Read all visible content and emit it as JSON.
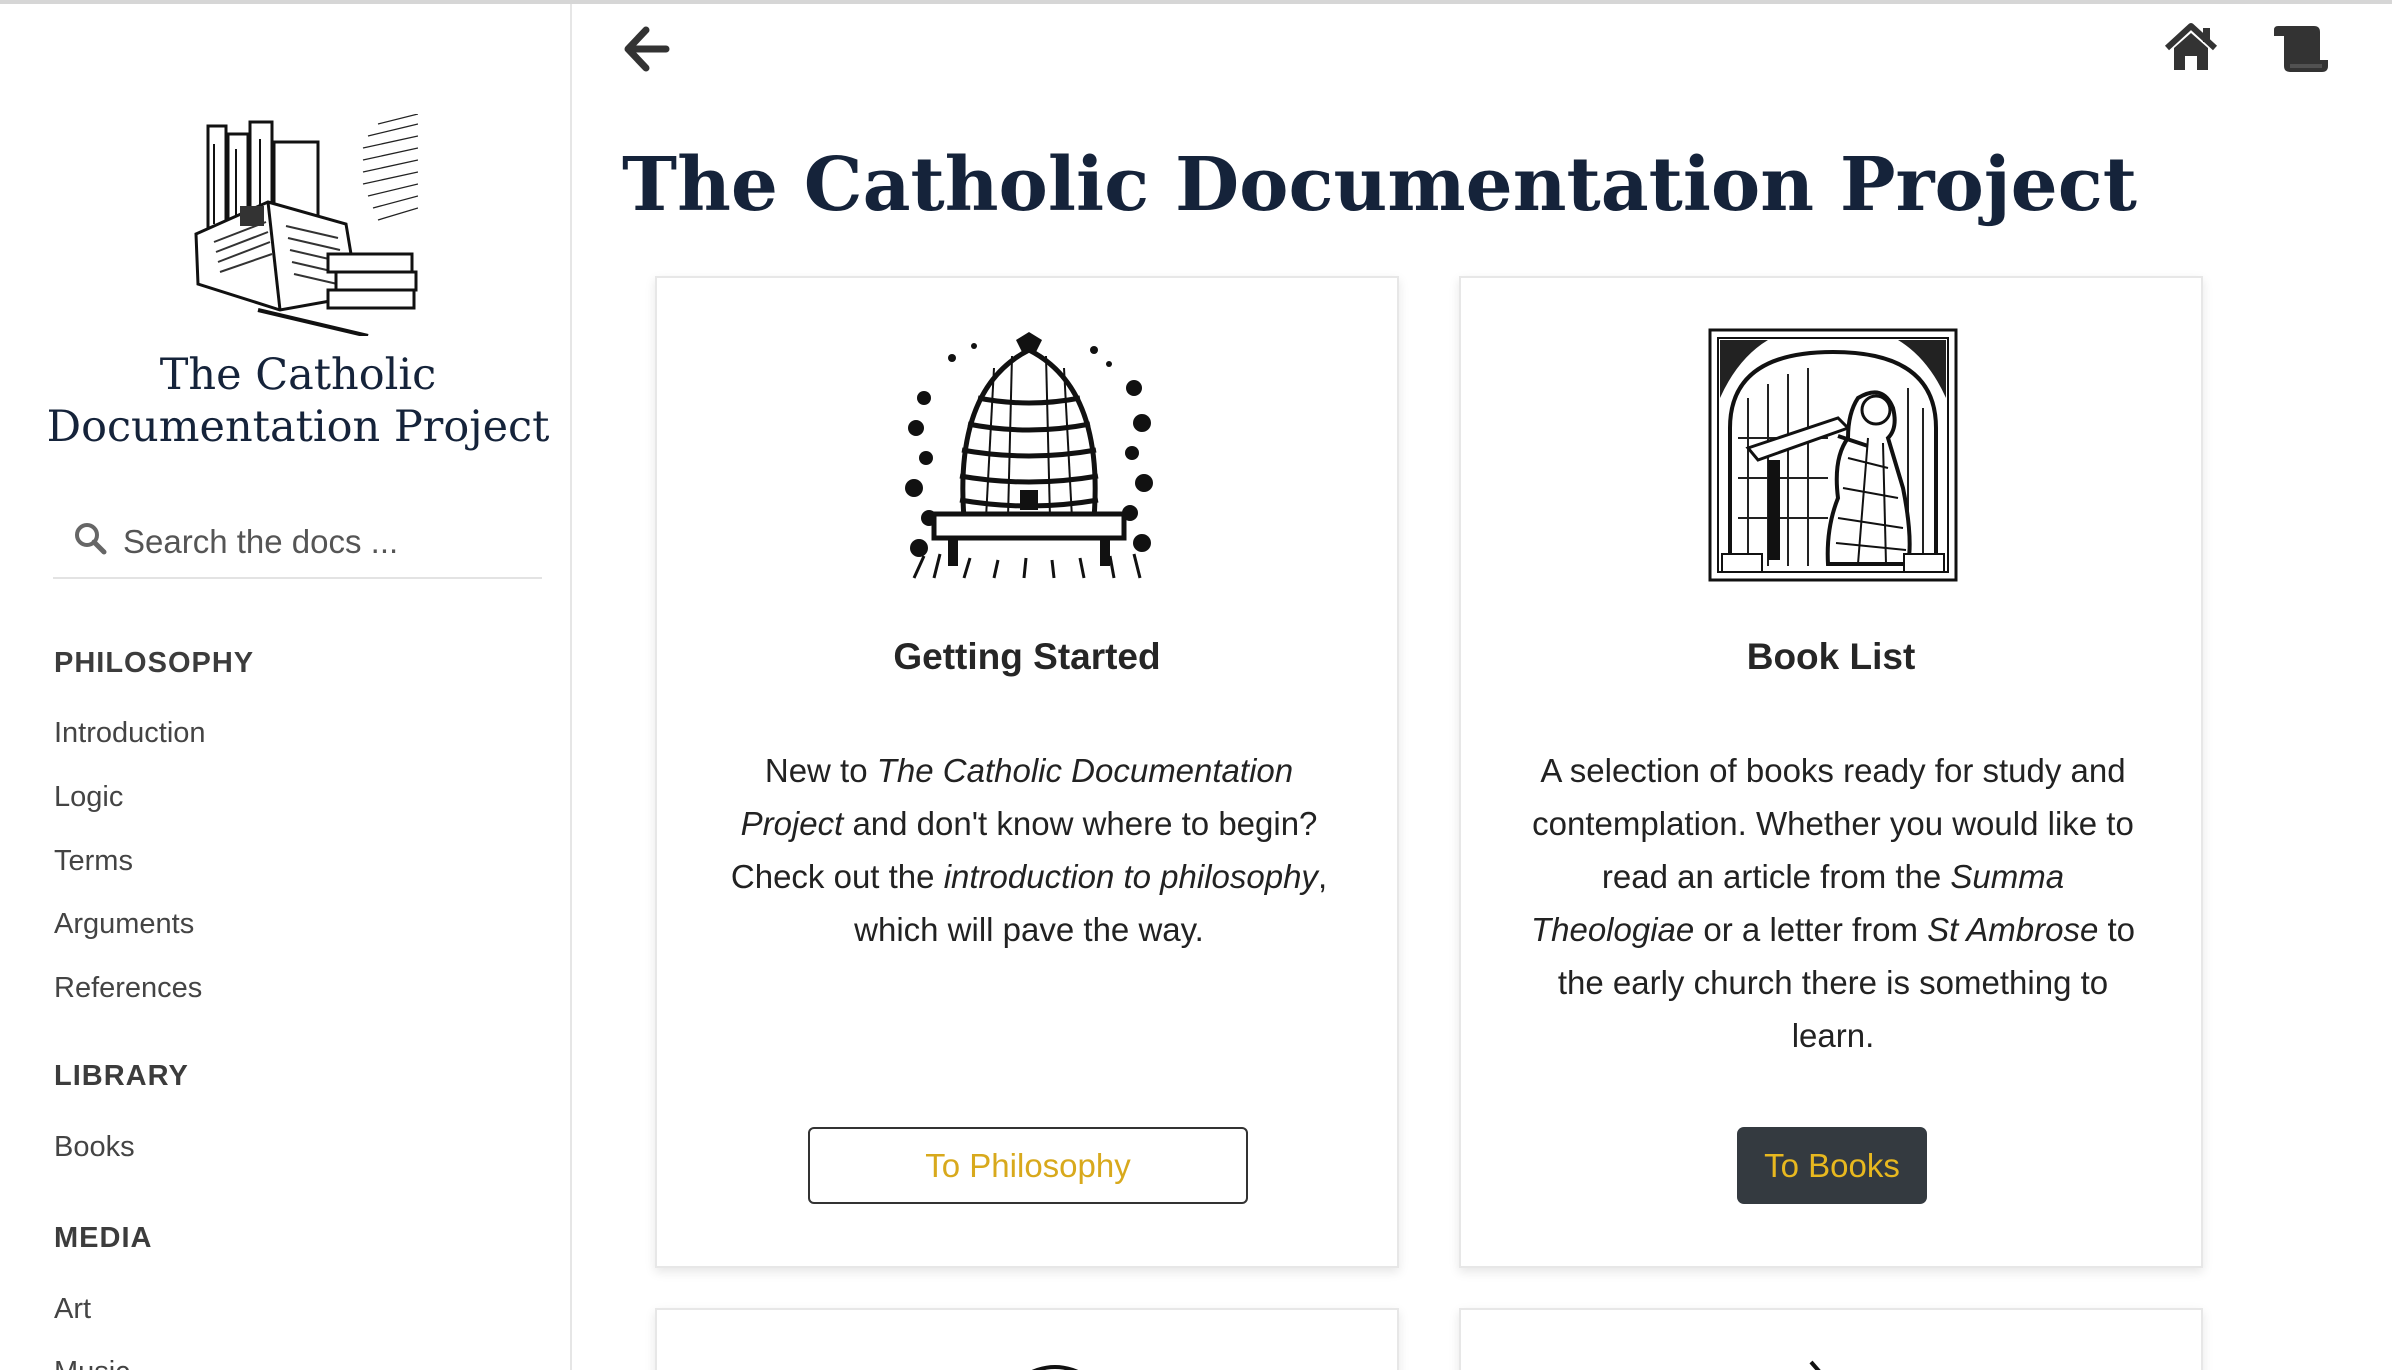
{
  "site": {
    "title_line1": "The Catholic",
    "title_line2": "Documentation Project"
  },
  "search": {
    "placeholder": "Search the docs ..."
  },
  "sidebar": {
    "sections": [
      {
        "heading": "PHILOSOPHY",
        "items": [
          "Introduction",
          "Logic",
          "Terms",
          "Arguments",
          "References"
        ]
      },
      {
        "heading": "LIBRARY",
        "items": [
          "Books"
        ]
      },
      {
        "heading": "MEDIA",
        "items": [
          "Art",
          "Music"
        ]
      }
    ]
  },
  "toolbar": {
    "back_icon": "arrow-left-icon",
    "home_icon": "home-icon",
    "scroll_icon": "scroll-icon"
  },
  "page": {
    "title": "The Catholic Documentation Project"
  },
  "cards": [
    {
      "title": "Getting Started",
      "text": [
        {
          "t": "New to ",
          "i": false
        },
        {
          "t": "The Catholic Documentation Project",
          "i": true
        },
        {
          "t": " and don't know where to begin? Check out the ",
          "i": false
        },
        {
          "t": "introduction to philosophy",
          "i": true
        },
        {
          "t": ", which will pave the way.",
          "i": false
        }
      ],
      "button": "To Philosophy",
      "image": "beehive-engraving"
    },
    {
      "title": "Book List",
      "text": [
        {
          "t": "A selection of books ready for study and contemplation. Whether you would like to read an article from the ",
          "i": false
        },
        {
          "t": "Summa Theologiae",
          "i": true
        },
        {
          "t": " or a letter from ",
          "i": false
        },
        {
          "t": "St Ambrose",
          "i": true
        },
        {
          "t": " to the early church there is something to learn.",
          "i": false
        }
      ],
      "button": "To Books",
      "image": "scribe-engraving"
    }
  ],
  "colors": {
    "title": "#15233a",
    "button_text": "#d8a91c",
    "button_dark_bg": "#343a40"
  }
}
